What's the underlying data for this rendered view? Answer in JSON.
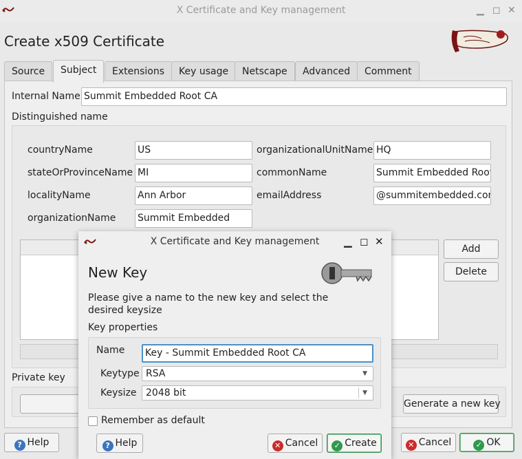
{
  "window": {
    "title": "X Certificate and Key management",
    "heading": "Create x509 Certificate"
  },
  "tabs": [
    {
      "label": "Source"
    },
    {
      "label": "Subject"
    },
    {
      "label": "Extensions"
    },
    {
      "label": "Key usage"
    },
    {
      "label": "Netscape"
    },
    {
      "label": "Advanced"
    },
    {
      "label": "Comment"
    }
  ],
  "subject": {
    "internal_name_label": "Internal Name",
    "internal_name_value": "Summit Embedded Root CA",
    "dn_label": "Distinguished name",
    "fields": {
      "countryName": {
        "label": "countryName",
        "value": "US"
      },
      "stateOrProvinceName": {
        "label": "stateOrProvinceName",
        "value": "MI"
      },
      "localityName": {
        "label": "localityName",
        "value": "Ann Arbor"
      },
      "organizationName": {
        "label": "organizationName",
        "value": "Summit Embedded"
      },
      "organizationalUnitName": {
        "label": "organizationalUnitName",
        "value": "HQ"
      },
      "commonName": {
        "label": "commonName",
        "value": "Summit Embedded Root"
      },
      "emailAddress": {
        "label": "emailAddress",
        "value": "@summitembedded.com"
      }
    },
    "add_label": "Add",
    "delete_label": "Delete",
    "private_key_label": "Private key",
    "generate_key_label": "Generate a new key"
  },
  "footer": {
    "help_label": "Help",
    "cancel_label": "Cancel",
    "ok_label": "OK"
  },
  "dialog": {
    "title": "X Certificate and Key management",
    "heading": "New Key",
    "description": "Please give a name to the new key and select the desired keysize",
    "group_label": "Key properties",
    "name_label": "Name",
    "name_value": "Key - Summit Embedded Root CA",
    "keytype_label": "Keytype",
    "keytype_value": "RSA",
    "keysize_label": "Keysize",
    "keysize_value": "2048 bit",
    "remember_label": "Remember as default",
    "help_label": "Help",
    "cancel_label": "Cancel",
    "create_label": "Create"
  },
  "colors": {
    "ok_green": "#2f9a4c",
    "cancel_red": "#cc2b2b",
    "help_blue": "#3d74bd"
  }
}
